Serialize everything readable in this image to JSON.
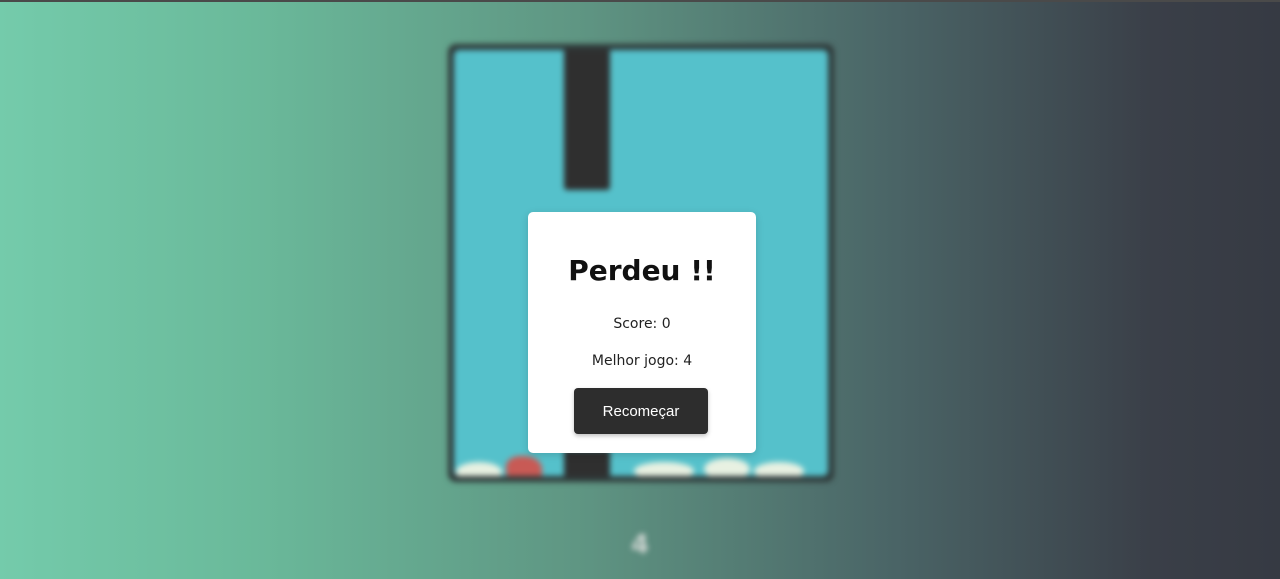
{
  "game": {
    "background_score": "4"
  },
  "modal": {
    "title": "Perdeu !!",
    "score_text": "Score: 0",
    "best_text": "Melhor jogo: 4",
    "restart_label": "Recomeçar"
  },
  "colors": {
    "sky": "#55c1cb",
    "pipe": "#2f2f2f",
    "button": "#2d2d2d",
    "gradient_left": "#74cbab",
    "gradient_right": "#363a43"
  }
}
